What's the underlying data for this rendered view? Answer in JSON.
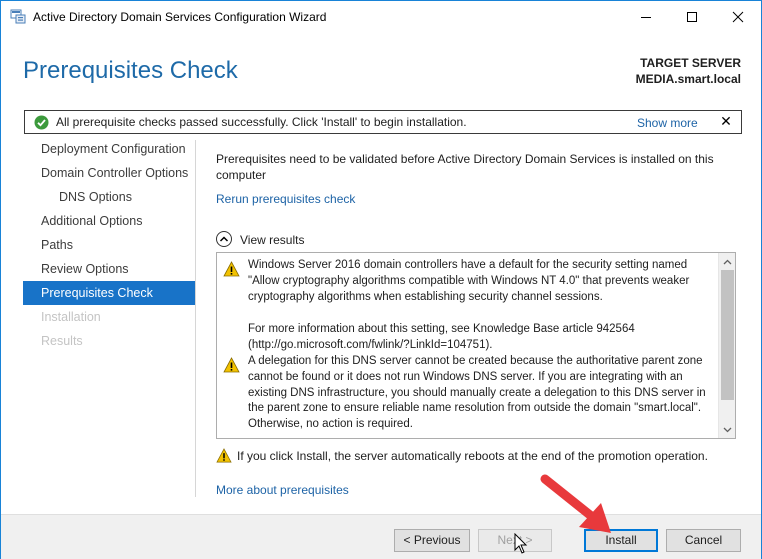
{
  "window": {
    "title": "Active Directory Domain Services Configuration Wizard",
    "border_color": "#1883d7"
  },
  "header": {
    "page_title": "Prerequisites Check",
    "target_label": "TARGET SERVER",
    "target_name": "MEDIA.smart.local"
  },
  "notification": {
    "icon": "check-circle-icon",
    "text": "All prerequisite checks passed successfully.  Click 'Install' to begin installation.",
    "show_more": "Show more",
    "close": "✕"
  },
  "sidebar": {
    "items": [
      {
        "label": "Deployment Configuration",
        "state": "normal"
      },
      {
        "label": "Domain Controller Options",
        "state": "normal"
      },
      {
        "label": "DNS Options",
        "state": "normal",
        "sub": true
      },
      {
        "label": "Additional Options",
        "state": "normal"
      },
      {
        "label": "Paths",
        "state": "normal"
      },
      {
        "label": "Review Options",
        "state": "normal"
      },
      {
        "label": "Prerequisites Check",
        "state": "active"
      },
      {
        "label": "Installation",
        "state": "disabled"
      },
      {
        "label": "Results",
        "state": "disabled"
      }
    ]
  },
  "content": {
    "description": "Prerequisites need to be validated before Active Directory Domain Services is installed on this computer",
    "rerun_link": "Rerun prerequisites check",
    "view_results_label": "View results",
    "results": [
      {
        "icon": "warning-icon",
        "paragraphs": [
          "Windows Server 2016 domain controllers have a default for the security setting named \"Allow cryptography algorithms compatible with Windows NT 4.0\" that prevents weaker cryptography algorithms when establishing security channel sessions.",
          "For more information about this setting, see Knowledge Base article 942564 (http://go.microsoft.com/fwlink/?LinkId=104751)."
        ]
      },
      {
        "icon": "warning-icon",
        "paragraphs": [
          "A delegation for this DNS server cannot be created because the authoritative parent zone cannot be found or it does not run Windows DNS server. If you are integrating with an existing DNS infrastructure, you should manually create a delegation to this DNS server in the parent zone to ensure reliable name resolution from outside the domain \"smart.local\". Otherwise, no action is required."
        ]
      }
    ],
    "reboot_warning": "If you click Install, the server automatically reboots at the end of the promotion operation.",
    "more_link": "More about prerequisites"
  },
  "footer": {
    "previous": "< Previous",
    "next": "Next >",
    "install": "Install",
    "cancel": "Cancel"
  },
  "colors": {
    "accent": "#1873c8",
    "link": "#1d63a6",
    "title": "#1e6aa8",
    "success": "#3c9a3c",
    "warning": "#f2c200",
    "annotation_arrow": "#e8393c"
  }
}
